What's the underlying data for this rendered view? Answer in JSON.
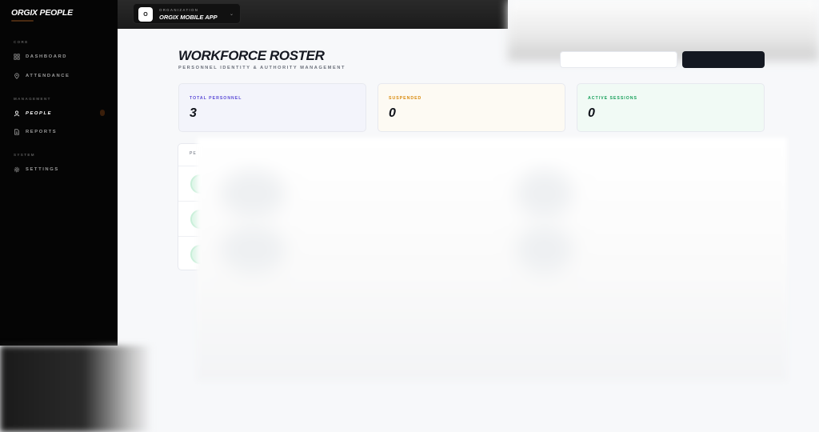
{
  "sidebar": {
    "brand": "ORGIX PEOPLE",
    "sections": [
      {
        "label": "CORE"
      },
      {
        "label": "MANAGEMENT"
      },
      {
        "label": "SYSTEM"
      }
    ],
    "items": [
      {
        "label": "DASHBOARD",
        "icon": "grid-icon"
      },
      {
        "label": "ATTENDANCE",
        "icon": "map-pin-icon"
      },
      {
        "label": "PEOPLE",
        "icon": "user-icon",
        "active": true
      },
      {
        "label": "REPORTS",
        "icon": "file-icon"
      },
      {
        "label": "SETTINGS",
        "icon": "gear-icon"
      }
    ]
  },
  "topbar": {
    "org_label": "ORGANIZATION",
    "org_name": "ORGIX MOBILE APP",
    "org_initial": "O"
  },
  "header": {
    "title": "WORKFORCE ROSTER",
    "subtitle": "PERSONNEL IDENTITY & AUTHORITY MANAGEMENT"
  },
  "stats": [
    {
      "label": "TOTAL PERSONNEL",
      "value": "3",
      "color": "#5b4bd6"
    },
    {
      "label": "SUSPENDED",
      "value": "0",
      "color": "#d98a0c"
    },
    {
      "label": "ACTIVE SESSIONS",
      "value": "0",
      "color": "#17a05a"
    }
  ],
  "table": {
    "header_partial": "PE"
  },
  "colors": {
    "sidebar_bg": "#050505",
    "topbar_bg": "#1b1b1b",
    "page_bg": "#f7f8fa",
    "primary_button": "#141821"
  }
}
